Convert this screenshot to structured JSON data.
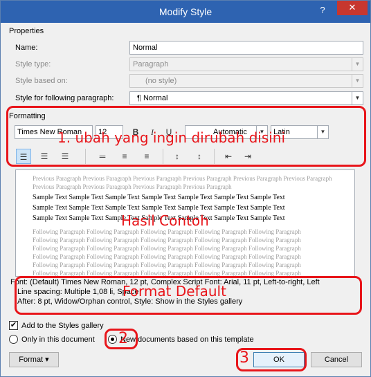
{
  "window": {
    "title": "Modify Style",
    "help_label": "?",
    "close_label": "✕"
  },
  "properties": {
    "group_label": "Properties",
    "name_label": "Name:",
    "name_value": "Normal",
    "style_type_label": "Style type:",
    "style_type_value": "Paragraph",
    "based_on_label": "Style based on:",
    "based_on_value": "(no style)",
    "following_label": "Style for following paragraph:",
    "following_value": "¶  Normal"
  },
  "formatting": {
    "group_label": "Formatting",
    "font_name": "Times New Roman",
    "font_size": "12",
    "bold": "B",
    "italic": "I",
    "underline": "U",
    "color_value": "Automatic",
    "script_value": "Latin"
  },
  "preview": {
    "previous_text": "Previous Paragraph Previous Paragraph Previous Paragraph Previous Paragraph Previous Paragraph Previous Paragraph Previous Paragraph Previous Paragraph Previous Paragraph Previous Paragraph",
    "sample_lines": [
      "Sample Text Sample Text Sample Text Sample Text Sample Text Sample Text Sample Text",
      "Sample Text Sample Text Sample Text Sample Text Sample Text Sample Text Sample Text",
      "Sample Text Sample Text Sample Text Sample Text Sample Text Sample Text Sample Text"
    ],
    "following_lines": [
      "Following Paragraph Following Paragraph Following Paragraph Following Paragraph Following Paragraph",
      "Following Paragraph Following Paragraph Following Paragraph Following Paragraph Following Paragraph",
      "Following Paragraph Following Paragraph Following Paragraph Following Paragraph Following Paragraph",
      "Following Paragraph Following Paragraph Following Paragraph Following Paragraph Following Paragraph",
      "Following Paragraph Following Paragraph Following Paragraph Following Paragraph Following Paragraph",
      "Following Paragraph Following Paragraph Following Paragraph Following Paragraph Following Paragraph"
    ]
  },
  "description": {
    "line1": "Font: (Default) Times New Roman, 12 pt, Complex Script Font: Arial, 11 pt, Left-to-right, Left",
    "line2": "Line spacing:  Multiple 1,08 li, Space",
    "line3": "After:  8 pt, Widow/Orphan control, Style: Show in the Styles gallery"
  },
  "options": {
    "add_gallery_label": "Add to the Styles gallery",
    "only_doc_label": "Only in this document",
    "new_docs_label": "New documents based on this template"
  },
  "buttons": {
    "format_label": "Format ▾",
    "ok_label": "OK",
    "cancel_label": "Cancel"
  },
  "annotations": {
    "a1": "1. ubah yang ingin dirubah disini",
    "a_hasil": "Hasil Contoh",
    "a_format": "Format Default",
    "a2": "2",
    "a3": "3"
  },
  "colors": {
    "titlebar": "#2e63b1",
    "close": "#c7372f",
    "annotation": "#e8151a"
  }
}
